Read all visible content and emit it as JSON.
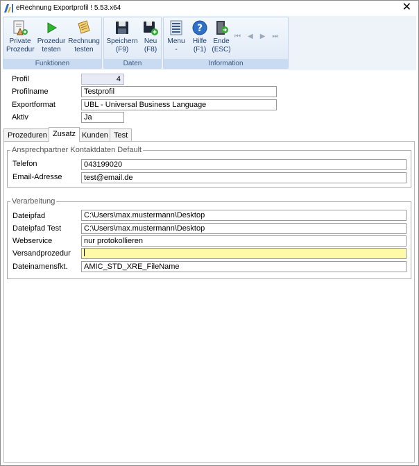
{
  "window": {
    "title": "eRechnung Exportprofil ! 5.53.x64",
    "close_glyph": "✕"
  },
  "ribbon": {
    "groups": [
      {
        "label": "Funktionen",
        "buttons": [
          {
            "line1": "Private",
            "line2": "Prozedur",
            "icon": "private-procedure-icon"
          },
          {
            "line1": "Prozedur",
            "line2": "testen",
            "icon": "play-icon"
          },
          {
            "line1": "Rechnung",
            "line2": "testen",
            "icon": "invoice-icon"
          }
        ]
      },
      {
        "label": "Daten",
        "buttons": [
          {
            "line1": "Speichern",
            "line2": "(F9)",
            "icon": "save-icon"
          },
          {
            "line1": "Neu",
            "line2": "(F8)",
            "icon": "new-icon"
          }
        ]
      },
      {
        "label": "Information",
        "buttons": [
          {
            "line1": "Menu",
            "line2": "-",
            "icon": "menu-icon"
          },
          {
            "line1": "Hilfe",
            "line2": "(F1)",
            "icon": "help-icon"
          },
          {
            "line1": "Ende",
            "line2": "(ESC)",
            "icon": "exit-icon"
          }
        ]
      }
    ],
    "nav": {
      "first": "⏮",
      "prev": "◀",
      "next": "▶",
      "last": "⏭"
    }
  },
  "form": {
    "profil": {
      "label": "Profil",
      "value": "4"
    },
    "profilname": {
      "label": "Profilname",
      "value": "Testprofil"
    },
    "exportformat": {
      "label": "Exportformat",
      "value": "UBL - Universal Business Language"
    },
    "aktiv": {
      "label": "Aktiv",
      "value": "Ja"
    }
  },
  "tabs": [
    {
      "label": "Prozeduren"
    },
    {
      "label": "Zusatz"
    },
    {
      "label": "Kunden"
    },
    {
      "label": "Test"
    }
  ],
  "contact_box": {
    "legend": "Ansprechpartner Kontaktdaten Default",
    "telefon": {
      "label": "Telefon",
      "value": "043199020"
    },
    "email": {
      "label": "Email-Adresse",
      "value": "test@email.de"
    }
  },
  "processing_box": {
    "legend": "Verarbeitung",
    "dateipfad": {
      "label": "Dateipfad",
      "value": "C:\\Users\\max.mustermann\\Desktop"
    },
    "dateipfad_test": {
      "label": "Dateipfad Test",
      "value": "C:\\Users\\max.mustermann\\Desktop"
    },
    "webservice": {
      "label": "Webservice",
      "value": "nur protokollieren"
    },
    "versandprozedur": {
      "label": "Versandprozedur",
      "value": ""
    },
    "dateinamensfkt": {
      "label": "Dateinamensfkt.",
      "value": "AMIC_STD_XRE_FileName"
    }
  },
  "colors": {
    "ribbon_label_bg": "#c9dbf0",
    "active_field_bg": "#fffaa8",
    "readonly_field_bg": "#e8eaf6"
  }
}
